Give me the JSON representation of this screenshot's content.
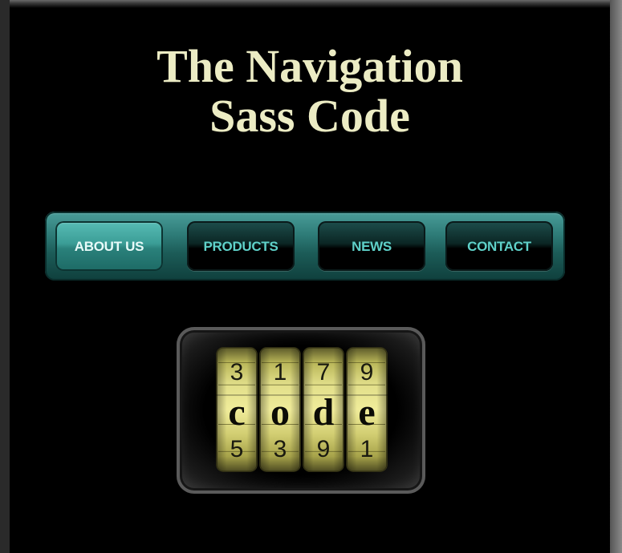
{
  "page": {
    "title_line1": "The Navigation",
    "title_line2": "Sass Code"
  },
  "nav": {
    "items": [
      {
        "label": "ABOUT US",
        "active": true
      },
      {
        "label": "PRODUCTS",
        "active": false
      },
      {
        "label": "NEWS",
        "active": false
      },
      {
        "label": "CONTACT",
        "active": false
      }
    ]
  },
  "lock_image": {
    "top_digits": [
      "3",
      "1",
      "7",
      "9"
    ],
    "middle_letters": [
      "c",
      "o",
      "d",
      "e"
    ],
    "bottom_digits": [
      "5",
      "3",
      "9",
      "1"
    ]
  },
  "colors": {
    "title": "#ececc4",
    "nav_teal": "#2d7a76",
    "nav_text": "#5fd1c9",
    "wheel_yellow": "#d6d47a"
  }
}
